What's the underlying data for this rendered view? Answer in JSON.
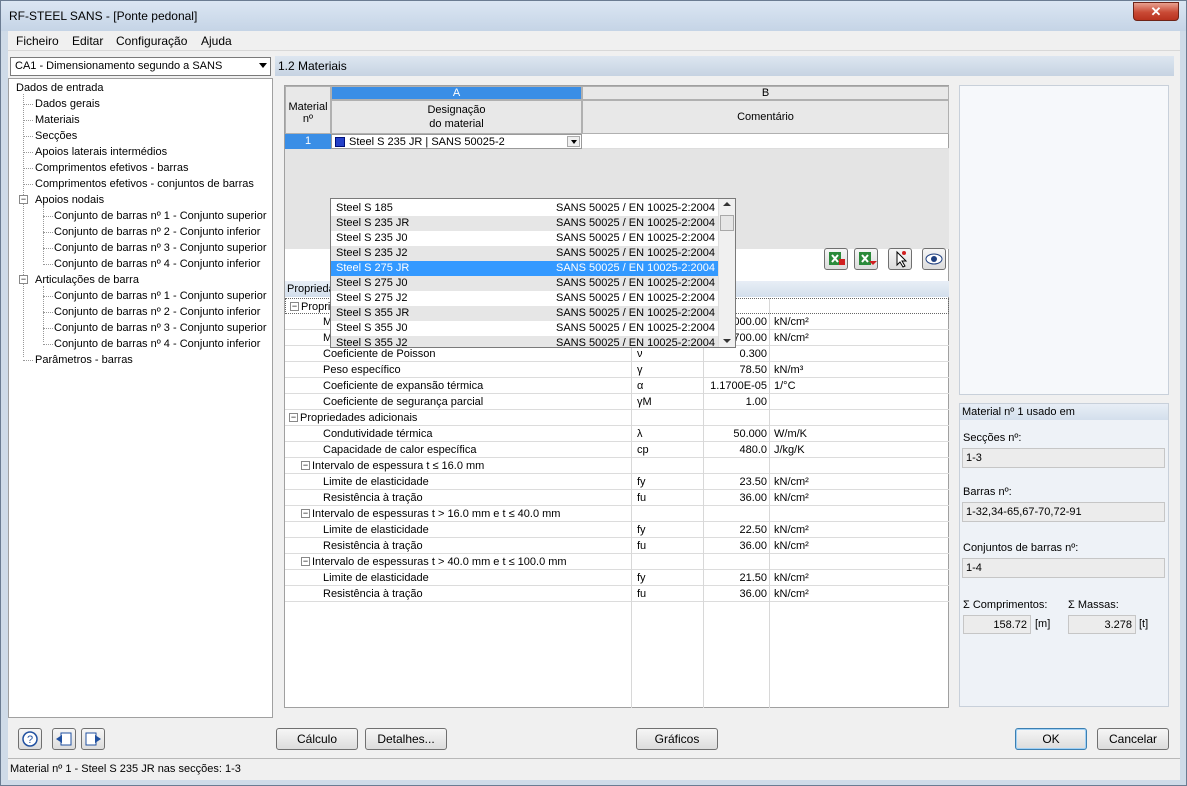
{
  "window": {
    "title": "RF-STEEL SANS - [Ponte pedonal]",
    "close": "✕"
  },
  "menu": [
    "Ficheiro",
    "Editar",
    "Configuração",
    "Ajuda"
  ],
  "case_combo": "CA1 - Dimensionamento segundo a SANS",
  "section_title": "1.2 Materiais",
  "tree": {
    "root": "Dados de entrada",
    "items": [
      "Dados gerais",
      "Materiais",
      "Secções",
      "Apoios laterais intermédios",
      "Comprimentos efetivos - barras",
      "Comprimentos efetivos - conjuntos de barras",
      "Apoios nodais",
      "Articulações de barra",
      "Parâmetros - barras"
    ],
    "apoios_children": [
      "Conjunto de barras nº 1 - Conjunto superior",
      "Conjunto de barras nº 2 - Conjunto inferior",
      "Conjunto de barras nº 3 - Conjunto superior",
      "Conjunto de barras nº 4 - Conjunto inferior"
    ],
    "artic_children": [
      "Conjunto de barras nº 1 - Conjunto superior",
      "Conjunto de barras nº 2 - Conjunto inferior",
      "Conjunto de barras nº 3 - Conjunto superior",
      "Conjunto de barras nº 4 - Conjunto inferior"
    ]
  },
  "table": {
    "col_a": "A",
    "col_b": "B",
    "hdr_mat_1": "Material",
    "hdr_mat_2": "nº",
    "hdr_desig_1": "Designação",
    "hdr_desig_2": "do material",
    "hdr_comment": "Comentário",
    "row_num": "1",
    "row_value": "Steel S 235 JR | SANS 50025-2"
  },
  "dropdown": [
    {
      "name": "Steel S 185",
      "norm": "SANS 50025 / EN 10025-2:2004",
      "sel": false
    },
    {
      "name": "Steel S 235 JR",
      "norm": "SANS 50025 / EN 10025-2:2004",
      "sel": false
    },
    {
      "name": "Steel S 235 J0",
      "norm": "SANS 50025 / EN 10025-2:2004",
      "sel": false
    },
    {
      "name": "Steel S 235 J2",
      "norm": "SANS 50025 / EN 10025-2:2004",
      "sel": false
    },
    {
      "name": "Steel S 275 JR",
      "norm": "SANS 50025 / EN 10025-2:2004",
      "sel": true
    },
    {
      "name": "Steel S 275 J0",
      "norm": "SANS 50025 / EN 10025-2:2004",
      "sel": false
    },
    {
      "name": "Steel S 275 J2",
      "norm": "SANS 50025 / EN 10025-2:2004",
      "sel": false
    },
    {
      "name": "Steel S 355 JR",
      "norm": "SANS 50025 / EN 10025-2:2004",
      "sel": false
    },
    {
      "name": "Steel S 355 J0",
      "norm": "SANS 50025 / EN 10025-2:2004",
      "sel": false
    },
    {
      "name": "Steel S 355 J2",
      "norm": "SANS 50025 / EN 10025-2:2004",
      "sel": false
    }
  ],
  "props_tab": "Propriedades",
  "properties": [
    {
      "kind": "group",
      "label": "Propriedades principais",
      "indent": 0
    },
    {
      "kind": "row",
      "label": "Módulo de elasticidade",
      "sym": "E",
      "val": "20000.00",
      "unit": "kN/cm²",
      "indent": 1
    },
    {
      "kind": "row",
      "label": "Módulo de corte",
      "sym": "G",
      "val": "7700.00",
      "unit": "kN/cm²",
      "indent": 1
    },
    {
      "kind": "row",
      "label": "Coeficiente de Poisson",
      "sym": "ν",
      "val": "0.300",
      "unit": "",
      "indent": 1
    },
    {
      "kind": "row",
      "label": "Peso específico",
      "sym": "γ",
      "val": "78.50",
      "unit": "kN/m³",
      "indent": 1
    },
    {
      "kind": "row",
      "label": "Coeficiente de expansão térmica",
      "sym": "α",
      "val": "1.1700E-05",
      "unit": "1/°C",
      "indent": 1
    },
    {
      "kind": "row",
      "label": "Coeficiente de segurança parcial",
      "sym": "γM",
      "val": "1.00",
      "unit": "",
      "indent": 1
    },
    {
      "kind": "group",
      "label": "Propriedades adicionais",
      "indent": 0
    },
    {
      "kind": "row",
      "label": "Condutividade térmica",
      "sym": "λ",
      "val": "50.000",
      "unit": "W/m/K",
      "indent": 1
    },
    {
      "kind": "row",
      "label": "Capacidade de calor específica",
      "sym": "cp",
      "val": "480.0",
      "unit": "J/kg/K",
      "indent": 1
    },
    {
      "kind": "group",
      "label": "Intervalo de espessura t ≤ 16.0 mm",
      "indent": 1
    },
    {
      "kind": "row",
      "label": "Limite de elasticidade",
      "sym": "fy",
      "val": "23.50",
      "unit": "kN/cm²",
      "indent": 2
    },
    {
      "kind": "row",
      "label": "Resistência à tração",
      "sym": "fu",
      "val": "36.00",
      "unit": "kN/cm²",
      "indent": 2
    },
    {
      "kind": "group",
      "label": "Intervalo de espessuras t > 16.0 mm e t ≤ 40.0 mm",
      "indent": 1
    },
    {
      "kind": "row",
      "label": "Limite de elasticidade",
      "sym": "fy",
      "val": "22.50",
      "unit": "kN/cm²",
      "indent": 2
    },
    {
      "kind": "row",
      "label": "Resistência à tração",
      "sym": "fu",
      "val": "36.00",
      "unit": "kN/cm²",
      "indent": 2
    },
    {
      "kind": "group",
      "label": "Intervalo de espessuras t > 40.0 mm e t ≤ 100.0 mm",
      "indent": 1
    },
    {
      "kind": "row",
      "label": "Limite de elasticidade",
      "sym": "fy",
      "val": "21.50",
      "unit": "kN/cm²",
      "indent": 2
    },
    {
      "kind": "row",
      "label": "Resistência à tração",
      "sym": "fu",
      "val": "36.00",
      "unit": "kN/cm²",
      "indent": 2
    }
  ],
  "usage": {
    "title": "Material nº 1 usado em",
    "sec_label": "Secções nº:",
    "sec_val": "1-3",
    "bar_label": "Barras nº:",
    "bar_val": "1-32,34-65,67-70,72-91",
    "set_label": "Conjuntos de barras nº:",
    "set_val": "1-4",
    "len_label": "Σ Comprimentos:",
    "len_val": "158.72",
    "len_unit": "[m]",
    "mass_label": "Σ Massas:",
    "mass_val": "3.278",
    "mass_unit": "[t]"
  },
  "buttons": {
    "calc": "Cálculo",
    "details": "Detalhes...",
    "graphics": "Gráficos",
    "ok": "OK",
    "cancel": "Cancelar"
  },
  "status": "Material nº 1 - Steel S 235 JR nas secções: 1-3"
}
